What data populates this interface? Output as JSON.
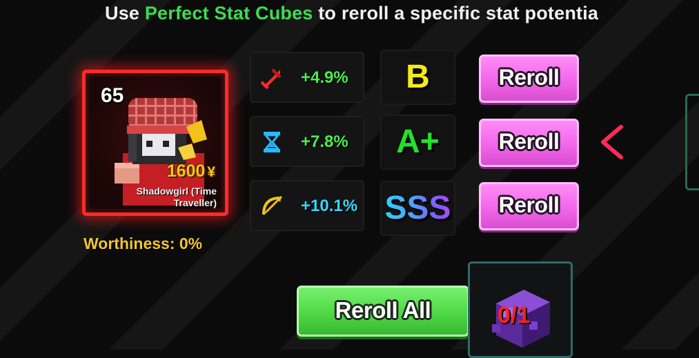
{
  "header": {
    "prefix": "Use ",
    "highlight": "Perfect Stat Cubes",
    "suffix": " to reroll a specific stat potentia"
  },
  "unit": {
    "level": "65",
    "price": "1600",
    "currency_symbol": "¥",
    "name": "Shadowgirl (Time Traveller)",
    "worthiness_label": "Worthiness: 0%",
    "rarity_color": "#ff2b2b"
  },
  "stats": [
    {
      "icon": "sword-damage-icon",
      "value": "+4.9%",
      "grade": "B",
      "button": "Reroll"
    },
    {
      "icon": "hourglass-cooldown-icon",
      "value": "+7.8%",
      "grade": "A+",
      "button": "Reroll"
    },
    {
      "icon": "bow-range-icon",
      "value": "+10.1%",
      "grade": "SSS",
      "button": "Reroll"
    }
  ],
  "actions": {
    "reroll_all": "Reroll All",
    "cube_count": "0/1",
    "cube_icon": "perfect-stat-cube-icon"
  },
  "colors": {
    "highlight_green": "#3ddc52",
    "reroll_pink": "#f266ea",
    "reroll_all_green": "#4fd846",
    "grade_b": "#f5ea19",
    "grade_a_plus": "#22e22a"
  }
}
